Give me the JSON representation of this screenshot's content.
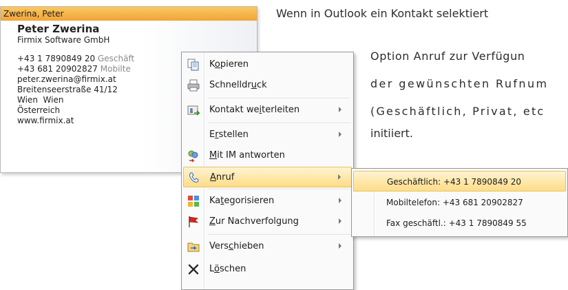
{
  "card": {
    "header": "Zwerina, Peter",
    "name": "Peter Zwerina",
    "company": "Firmix Software GmbH",
    "phones": [
      {
        "number": "+43 1 7890849 20",
        "label": "Geschäft"
      },
      {
        "number": "+43 681 20902827",
        "label": "Mobilte"
      }
    ],
    "email": "peter.zwerina@firmix.at",
    "street": "Breitenseerstraße 41/12",
    "city": "Wien  Wien",
    "country": "Österreich",
    "web": "www.firmix.at"
  },
  "article": [
    "Wenn in Outlook ein Kontakt selektiert",
    "Option Anruf zur Verfügun",
    "der gewünschten Rufnum",
    "(Geschäftlich, Privat, etc",
    "initiiert."
  ],
  "menu": {
    "items": [
      {
        "pre": "K",
        "acc": "o",
        "post": "pieren",
        "icon": "copy-icon"
      },
      {
        "pre": "Schnelldr",
        "acc": "u",
        "post": "ck",
        "icon": "print-icon"
      },
      {
        "pre": "Kontakt we",
        "acc": "i",
        "post": "terleiten",
        "icon": "forward-contact-icon"
      },
      {
        "pre": "E",
        "acc": "r",
        "post": "stellen",
        "icon": ""
      },
      {
        "pre": "",
        "acc": "M",
        "post": "it IM antworten",
        "icon": "im-reply-icon"
      },
      {
        "pre": "",
        "acc": "A",
        "post": "nruf",
        "icon": "phone-icon"
      },
      {
        "pre": "Ka",
        "acc": "t",
        "post": "egorisieren",
        "icon": "categorize-icon"
      },
      {
        "pre": "",
        "acc": "Z",
        "post": "ur Nachverfolgung",
        "icon": "follow-up-flag-icon"
      },
      {
        "pre": "Vers",
        "acc": "c",
        "post": "hieben",
        "icon": "move-folder-icon"
      },
      {
        "pre": "L",
        "acc": "ö",
        "post": "schen",
        "icon": "delete-icon"
      }
    ]
  },
  "submenu": {
    "items": [
      {
        "label": "Geschäftlich: +43 1 7890849 20"
      },
      {
        "label": "Mobiltelefon: +43 681 20902827"
      },
      {
        "label": "Fax geschäftl.: +43 1 7890849 55"
      }
    ]
  },
  "colors": {
    "card_header": "#f5b547",
    "highlight": "#ffe6a0",
    "highlight_border": "#e5c365"
  }
}
